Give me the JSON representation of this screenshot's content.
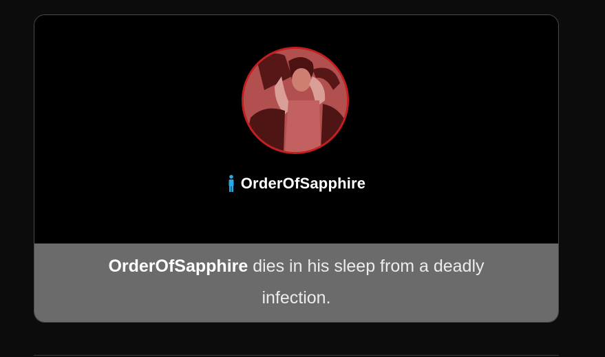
{
  "card": {
    "username": "OrderOfSapphire",
    "gender_icon": "male-person-icon",
    "avatar_icon": "profile-avatar",
    "message": {
      "name": "OrderOfSapphire",
      "text": " dies in his sleep from a deadly infection."
    }
  },
  "colors": {
    "page_bg": "#0c0c0c",
    "card_bg": "#000000",
    "footer_bg": "#6b6b6b",
    "avatar_ring": "#c41e1e",
    "gender_icon": "#2aa8e6"
  }
}
